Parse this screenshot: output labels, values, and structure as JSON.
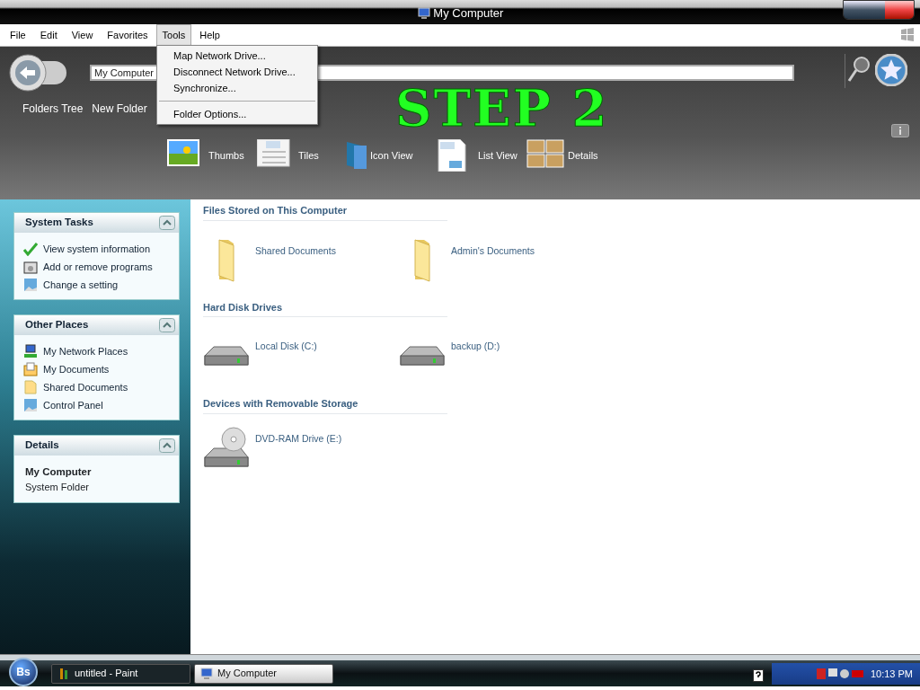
{
  "window": {
    "title": "My Computer"
  },
  "menu_bar": [
    {
      "label": "File",
      "selected": false
    },
    {
      "label": "Edit",
      "selected": false
    },
    {
      "label": "View",
      "selected": false
    },
    {
      "label": "Favorites",
      "selected": false
    },
    {
      "label": "Tools",
      "selected": true
    },
    {
      "label": "Help",
      "selected": false
    }
  ],
  "tools_menu": [
    {
      "kind": "item",
      "label": "Map Network Drive..."
    },
    {
      "kind": "item",
      "label": "Disconnect Network Drive..."
    },
    {
      "kind": "item",
      "label": "Synchronize..."
    },
    {
      "kind": "separator"
    },
    {
      "kind": "item",
      "label": "Folder Options..."
    }
  ],
  "toolbar": {
    "address": "My Computer",
    "buttons": [
      "Folders Tree",
      "New Folder"
    ],
    "views": [
      {
        "kind": "thumbs",
        "label": "Thumbs"
      },
      {
        "kind": "tiles",
        "label": "Tiles"
      },
      {
        "kind": "icons",
        "label": "Icon View"
      },
      {
        "kind": "list",
        "label": "List View"
      },
      {
        "kind": "details",
        "label": "Details"
      }
    ]
  },
  "annotation": "STEP 2",
  "sidebar": [
    {
      "title": "System Tasks",
      "expanded": true,
      "items": [
        {
          "kind": "check",
          "label": "View system information"
        },
        {
          "kind": "programs",
          "label": "Add or remove programs"
        },
        {
          "kind": "picture",
          "label": "Change a setting"
        }
      ]
    },
    {
      "title": "Other Places",
      "expanded": true,
      "items": [
        {
          "kind": "network",
          "label": "My Network Places"
        },
        {
          "kind": "documents",
          "label": "My Documents"
        },
        {
          "kind": "folder",
          "label": "Shared Documents"
        },
        {
          "kind": "picture",
          "label": "Control Panel"
        }
      ]
    }
  ],
  "details": {
    "title": "Details",
    "expanded": true,
    "name": "My Computer",
    "description": "System Folder"
  },
  "sections": [
    {
      "heading": "Files Stored on This Computer",
      "items": [
        {
          "kind": "folder",
          "label": "Shared Documents"
        },
        {
          "kind": "folder",
          "label": "Admin's Documents"
        }
      ]
    },
    {
      "heading": "Hard Disk Drives",
      "items": [
        {
          "kind": "disk",
          "label": "Local Disk (C:)"
        },
        {
          "kind": "disk",
          "label": "backup (D:)"
        }
      ]
    },
    {
      "heading": "Devices with Removable Storage",
      "items": [
        {
          "kind": "dvd",
          "label": "DVD-RAM Drive (E:)"
        }
      ]
    }
  ],
  "taskbar": {
    "start": "Bs",
    "tasks": [
      {
        "label": "untitled - Paint",
        "selected": false
      },
      {
        "label": "My Computer",
        "selected": true
      }
    ],
    "clock": "10:13 PM"
  }
}
